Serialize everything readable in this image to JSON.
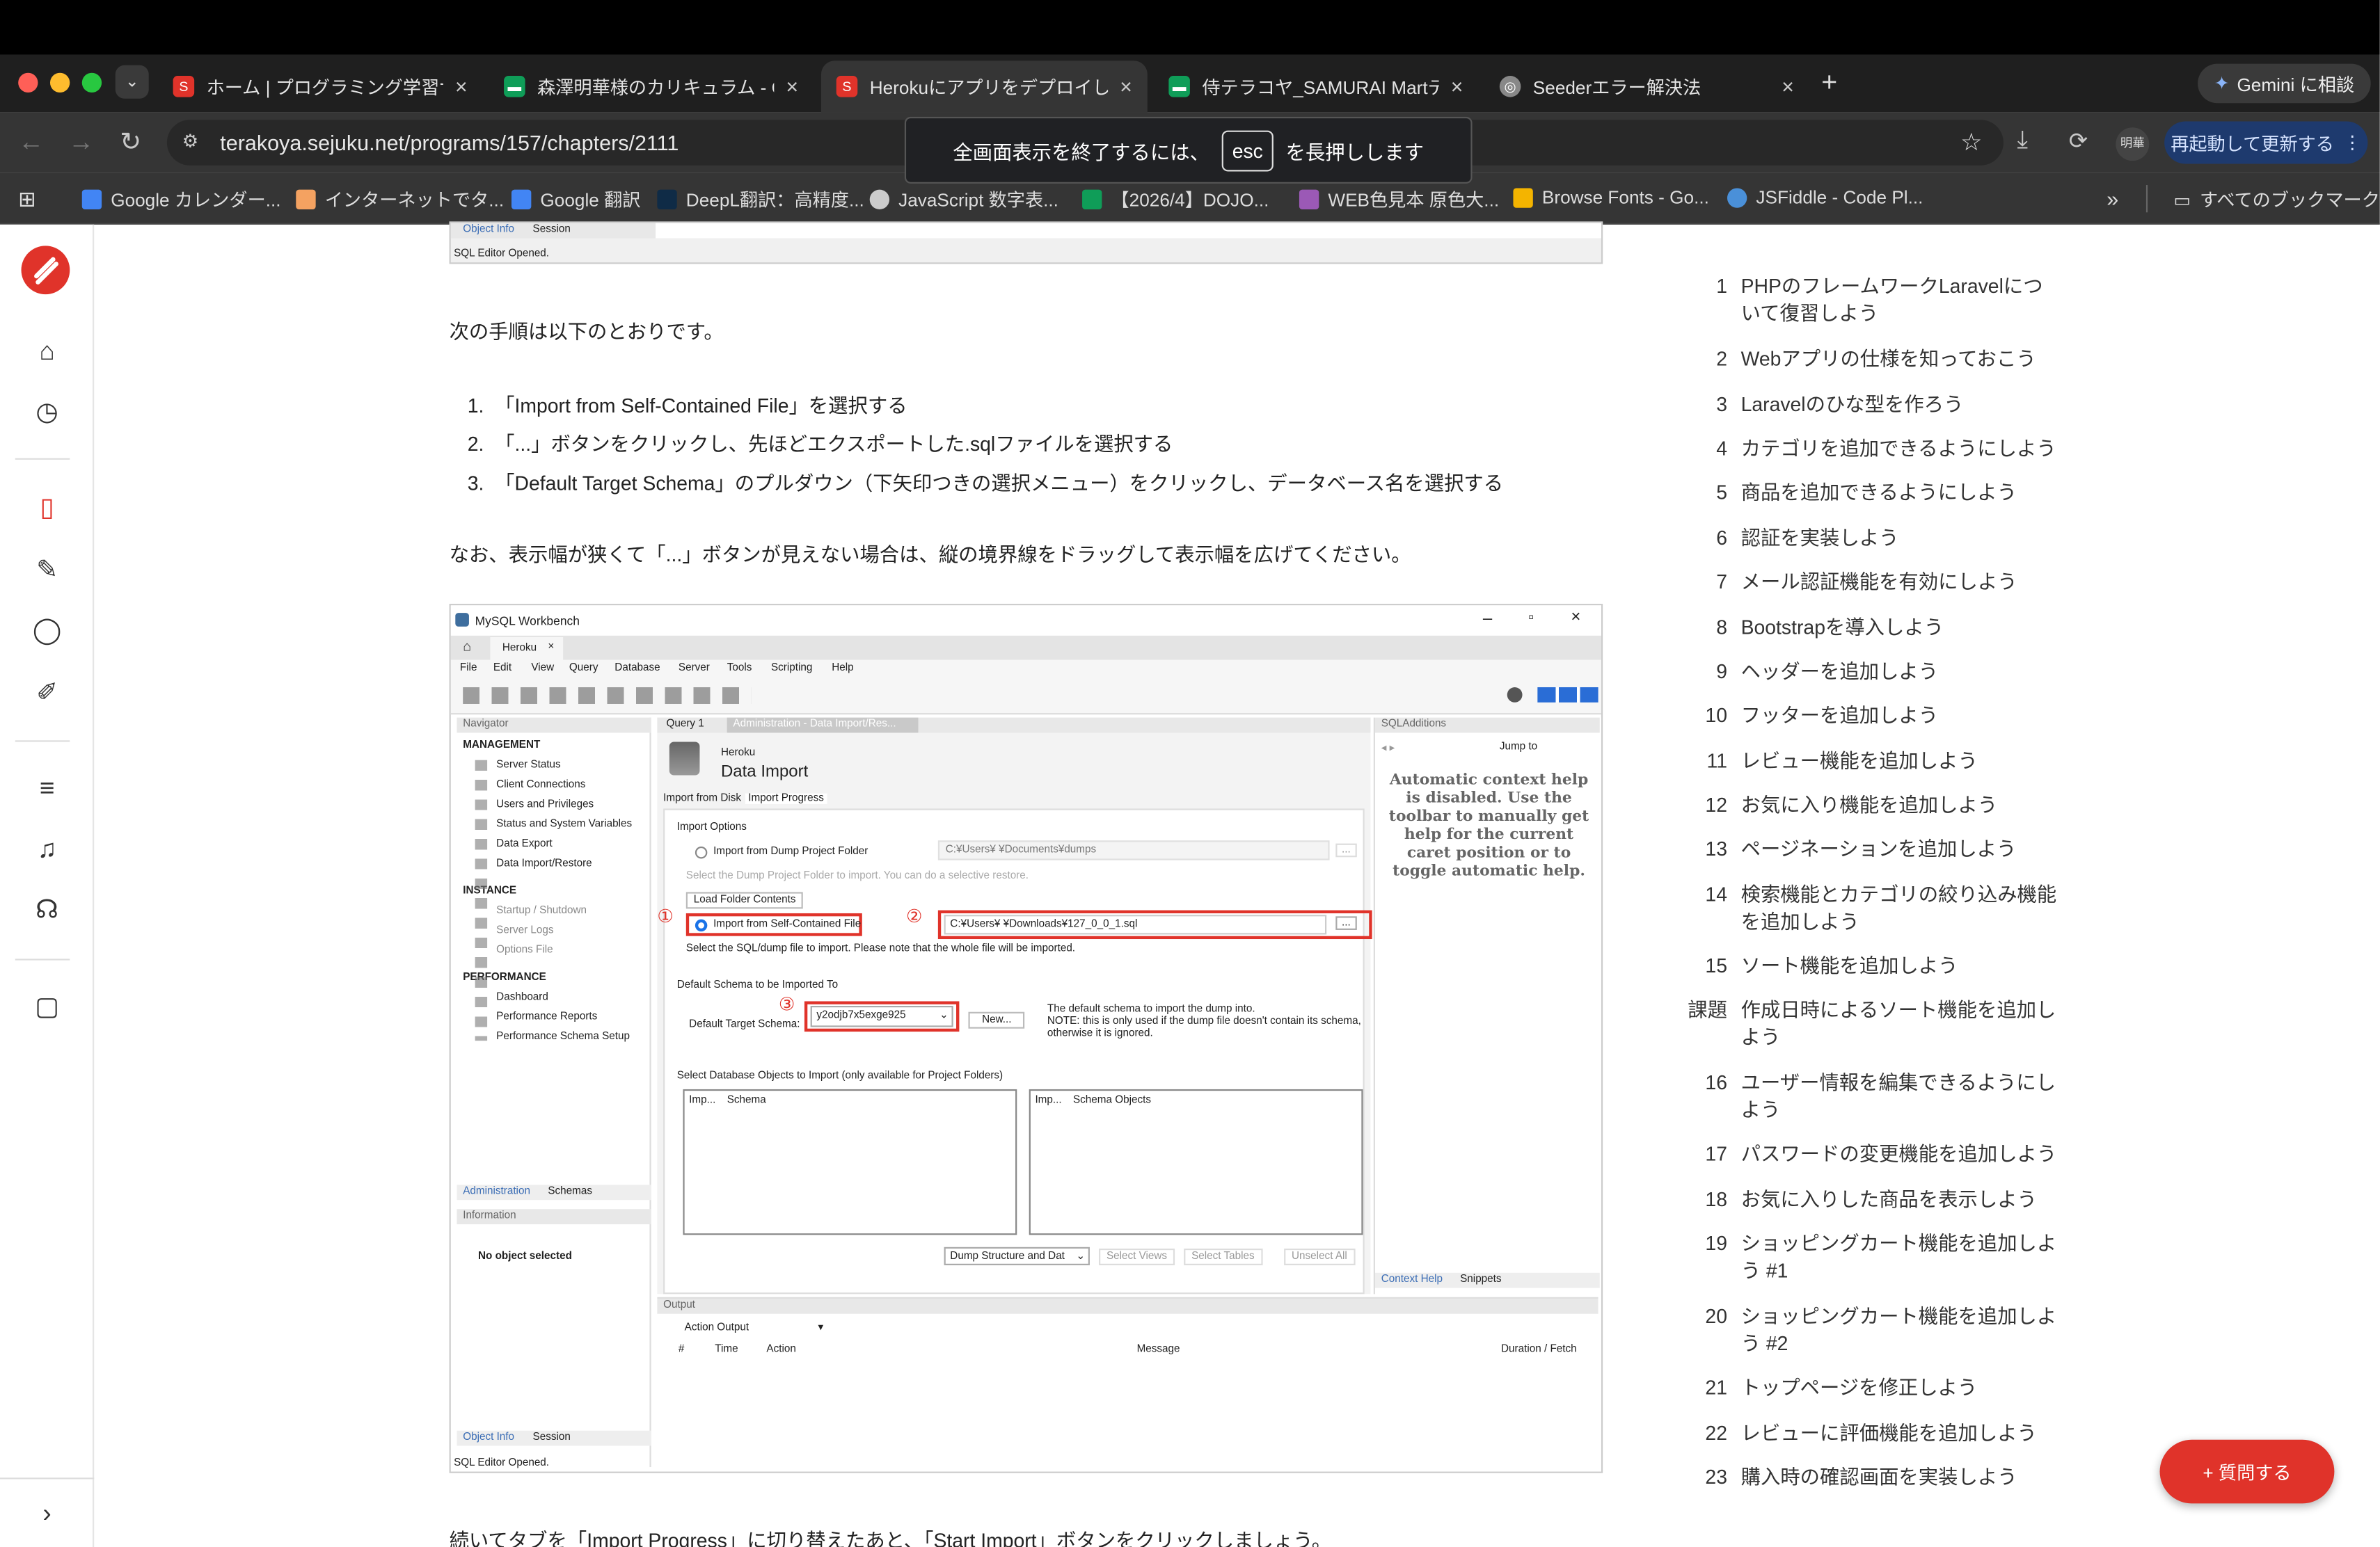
{
  "browser": {
    "tabs": [
      {
        "title": "ホーム | プログラミング学習サイ",
        "favicon_color": "#e0332a"
      },
      {
        "title": "森澤明華様のカリキュラム - Go",
        "favicon_color": "#0f9d58"
      },
      {
        "title": "Herokuにアプリをデプロイしよ",
        "favicon_color": "#e0332a"
      },
      {
        "title": "侍テラコヤ_SAMURAI Martテス",
        "favicon_color": "#0f9d58"
      },
      {
        "title": "Seederエラー解決法",
        "favicon_color": "#aaaaaa"
      }
    ],
    "new_tab_label": "+",
    "gemini_label": "Gemini に相談",
    "url": "terakoya.sejuku.net/programs/157/chapters/2111",
    "profile_label": "明華",
    "update_label": "再起動して更新する",
    "fullscreen_toast": {
      "before": "全画面表示を終了するには、",
      "key": "esc",
      "after": "を長押しします"
    },
    "bookmarks": [
      {
        "label": "Google カレンダー...",
        "color": "#4285f4"
      },
      {
        "label": "インターネットでタ...",
        "color": "#f4a261"
      },
      {
        "label": "Google 翻訳",
        "color": "#4285f4"
      },
      {
        "label": "DeepL翻訳：高精度...",
        "color": "#0f2b46"
      },
      {
        "label": "JavaScript 数字表...",
        "color": "#cccccc"
      },
      {
        "label": "【2026/4】DOJO...",
        "color": "#0f9d58"
      },
      {
        "label": "WEB色見本 原色大...",
        "color": "#9b59b6"
      },
      {
        "label": "Browse Fonts - Go...",
        "color": "#f4b400"
      },
      {
        "label": "JSFiddle - Code Pl...",
        "color": "#4a90d9"
      }
    ],
    "all_bookmarks_label": "すべてのブックマーク"
  },
  "content": {
    "top_strip": {
      "tab_object_info": "Object Info",
      "tab_session": "Session",
      "status": "SQL Editor Opened."
    },
    "intro": "次の手順は以下のとおりです。",
    "steps": [
      "「Import from Self-Contained File」を選択する",
      "「...」ボタンをクリックし、先ほどエクスポートした.sqlファイルを選択する",
      "「Default Target Schema」のプルダウン（下矢印つきの選択メニュー）をクリックし、データベース名を選択する"
    ],
    "note": "なお、表示幅が狭くて「...」ボタンが見えない場合は、縦の境界線をドラッグして表示幅を広げてください。",
    "outro": "続いてタブを「Import Progress」に切り替えたあと、「Start Import」ボタンをクリックしましょう。"
  },
  "workbench": {
    "title": "MySQL Workbench",
    "conn_tab": "Heroku",
    "menu": [
      "File",
      "Edit",
      "View",
      "Query",
      "Database",
      "Server",
      "Tools",
      "Scripting",
      "Help"
    ],
    "navigator": "Navigator",
    "management": "MANAGEMENT",
    "mgmt_items": [
      "Server Status",
      "Client Connections",
      "Users and Privileges",
      "Status and System Variables",
      "Data Export",
      "Data Import/Restore"
    ],
    "instance": "INSTANCE",
    "instance_items": [
      "Startup / Shutdown",
      "Server Logs",
      "Options File"
    ],
    "performance": "PERFORMANCE",
    "perf_items": [
      "Dashboard",
      "Performance Reports",
      "Performance Schema Setup"
    ],
    "nav_tabs": [
      "Administration",
      "Schemas"
    ],
    "information": "Information",
    "no_object": "No object selected",
    "bottom_tabs": [
      "Object Info",
      "Session"
    ],
    "status": "SQL Editor Opened.",
    "query_tab": "Query 1",
    "admin_tab": "Administration - Data Import/Res...",
    "di_small": "Heroku",
    "di_title": "Data Import",
    "subtabs": [
      "Import from Disk",
      "Import Progress"
    ],
    "import_options": "Import Options",
    "opt_folder": "Import from Dump Project Folder",
    "folder_path": "C:¥Users¥     ¥Documents¥dumps",
    "folder_hint": "Select the Dump Project Folder to import. You can do a selective restore.",
    "load_folder": "Load Folder Contents",
    "opt_file": "Import from Self-Contained File",
    "file_path": "C:¥Users¥     ¥Downloads¥127_0_0_1.sql",
    "ellipsis": "...",
    "file_hint": "Select the SQL/dump file to import. Please note that the whole file will be imported.",
    "default_schema_title": "Default Schema to be Imported To",
    "default_target_label": "Default Target Schema:",
    "default_target_value": "y2odjb7x5exge925",
    "new_btn": "New...",
    "schema_note": "The default schema to import the dump into.\nNOTE: this is only used if the dump file doesn't contain its schema, otherwise it is ignored.",
    "select_objects": "Select Database Objects to Import (only available for Project Folders)",
    "col_imp": "Imp...",
    "col_schema": "Schema",
    "col_schema_objects": "Schema Objects",
    "dump_select": "Dump Structure and Dat",
    "btn_views": "Select Views",
    "btn_tables": "Select Tables",
    "btn_unselect": "Unselect All",
    "sql_additions": "SQLAdditions",
    "jump_to": "Jump to",
    "help_text": "Automatic context help is disabled. Use the toolbar to manually get help for the current caret position or to toggle automatic help.",
    "right_tabs": [
      "Context Help",
      "Snippets"
    ],
    "output": "Output",
    "action_output": "Action Output",
    "out_cols": [
      "#",
      "Time",
      "Action",
      "Message",
      "Duration / Fetch"
    ],
    "markers": [
      "①",
      "②",
      "③"
    ]
  },
  "toc": {
    "items": [
      {
        "num": "1",
        "label": "PHPのフレームワークLaravelについて復習しよう"
      },
      {
        "num": "2",
        "label": "Webアプリの仕様を知っておこう"
      },
      {
        "num": "3",
        "label": "Laravelのひな型を作ろう"
      },
      {
        "num": "4",
        "label": "カテゴリを追加できるようにしよう"
      },
      {
        "num": "5",
        "label": "商品を追加できるようにしよう"
      },
      {
        "num": "6",
        "label": "認証を実装しよう"
      },
      {
        "num": "7",
        "label": "メール認証機能を有効にしよう"
      },
      {
        "num": "8",
        "label": "Bootstrapを導入しよう"
      },
      {
        "num": "9",
        "label": "ヘッダーを追加しよう"
      },
      {
        "num": "10",
        "label": "フッターを追加しよう"
      },
      {
        "num": "11",
        "label": "レビュー機能を追加しよう"
      },
      {
        "num": "12",
        "label": "お気に入り機能を追加しよう"
      },
      {
        "num": "13",
        "label": "ページネーションを追加しよう"
      },
      {
        "num": "14",
        "label": "検索機能とカテゴリの絞り込み機能を追加しよう"
      },
      {
        "num": "15",
        "label": "ソート機能を追加しよう"
      },
      {
        "num": "課題",
        "label": "作成日時によるソート機能を追加しよう"
      },
      {
        "num": "16",
        "label": "ユーザー情報を編集できるようにしよう"
      },
      {
        "num": "17",
        "label": "パスワードの変更機能を追加しよう"
      },
      {
        "num": "18",
        "label": "お気に入りした商品を表示しよう"
      },
      {
        "num": "19",
        "label": "ショッピングカート機能を追加しよう #1"
      },
      {
        "num": "20",
        "label": "ショッピングカート機能を追加しよう #2"
      },
      {
        "num": "21",
        "label": "トップページを修正しよう"
      },
      {
        "num": "22",
        "label": "レビューに評価機能を追加しよう"
      },
      {
        "num": "23",
        "label": "購入時の確認画面を実装しよう"
      }
    ]
  },
  "ask_button": "+ 質問する",
  "colors": {
    "brand": "#e0332a"
  }
}
